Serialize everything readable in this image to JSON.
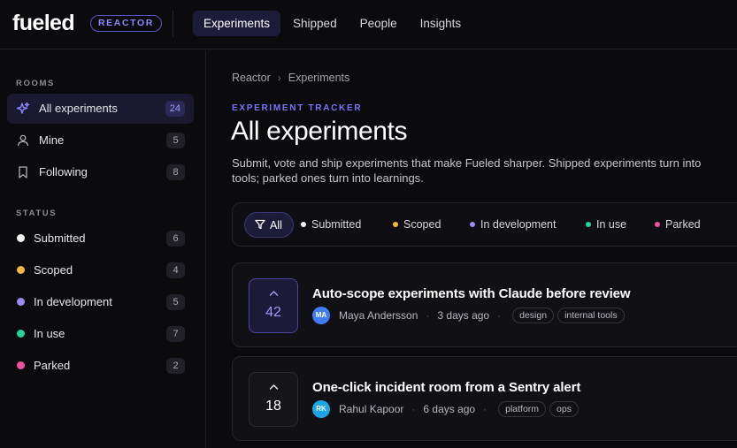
{
  "brand": {
    "logo": "fueled",
    "badge": "REACTOR",
    "accent": "#7b73ff"
  },
  "nav": {
    "items": [
      {
        "label": "Experiments",
        "active": true
      },
      {
        "label": "Shipped"
      },
      {
        "label": "People"
      },
      {
        "label": "Insights"
      }
    ]
  },
  "sidebar": {
    "rooms_label": "ROOMS",
    "rooms": [
      {
        "label": "All experiments",
        "count": "24",
        "icon": "sparkles-icon",
        "active": true
      },
      {
        "label": "Mine",
        "count": "5",
        "icon": "user-icon"
      },
      {
        "label": "Following",
        "count": "8",
        "icon": "bookmark-icon"
      }
    ],
    "status_label": "STATUS",
    "statuses": [
      {
        "label": "Submitted",
        "count": "6",
        "color": "#f2f2f2"
      },
      {
        "label": "Scoped",
        "count": "4",
        "color": "#f4b740"
      },
      {
        "label": "In development",
        "count": "5",
        "color": "#9b8cf5"
      },
      {
        "label": "In use",
        "count": "7",
        "color": "#22d39a"
      },
      {
        "label": "Parked",
        "count": "2",
        "color": "#f04fa2"
      }
    ]
  },
  "main": {
    "breadcrumb": [
      "Reactor",
      "Experiments"
    ],
    "eyebrow": "EXPERIMENT TRACKER",
    "title": "All experiments",
    "subtitle": "Submit, vote and ship experiments that make Fueled sharper. Shipped experiments turn into tools; parked ones turn into learnings.",
    "filters": {
      "all_label": "All",
      "items": [
        {
          "label": "Submitted",
          "color": "#f2f2f2"
        },
        {
          "label": "Scoped",
          "color": "#f4b740"
        },
        {
          "label": "In development",
          "color": "#9b8cf5"
        },
        {
          "label": "In use",
          "color": "#22d39a"
        },
        {
          "label": "Parked",
          "color": "#f04fa2"
        }
      ]
    },
    "experiments": [
      {
        "votes": "42",
        "voted": true,
        "title": "Auto-scope experiments with Claude before review",
        "initials": "MA",
        "avatar_color": "#3f7df0",
        "author": "Maya Andersson",
        "time": "3 days ago",
        "tags": [
          "design",
          "internal tools"
        ]
      },
      {
        "votes": "18",
        "voted": false,
        "title": "One-click incident room from a Sentry alert",
        "initials": "RK",
        "avatar_color": "#1ba7e6",
        "author": "Rahul Kapoor",
        "time": "6 days ago",
        "tags": [
          "platform",
          "ops"
        ]
      }
    ]
  }
}
